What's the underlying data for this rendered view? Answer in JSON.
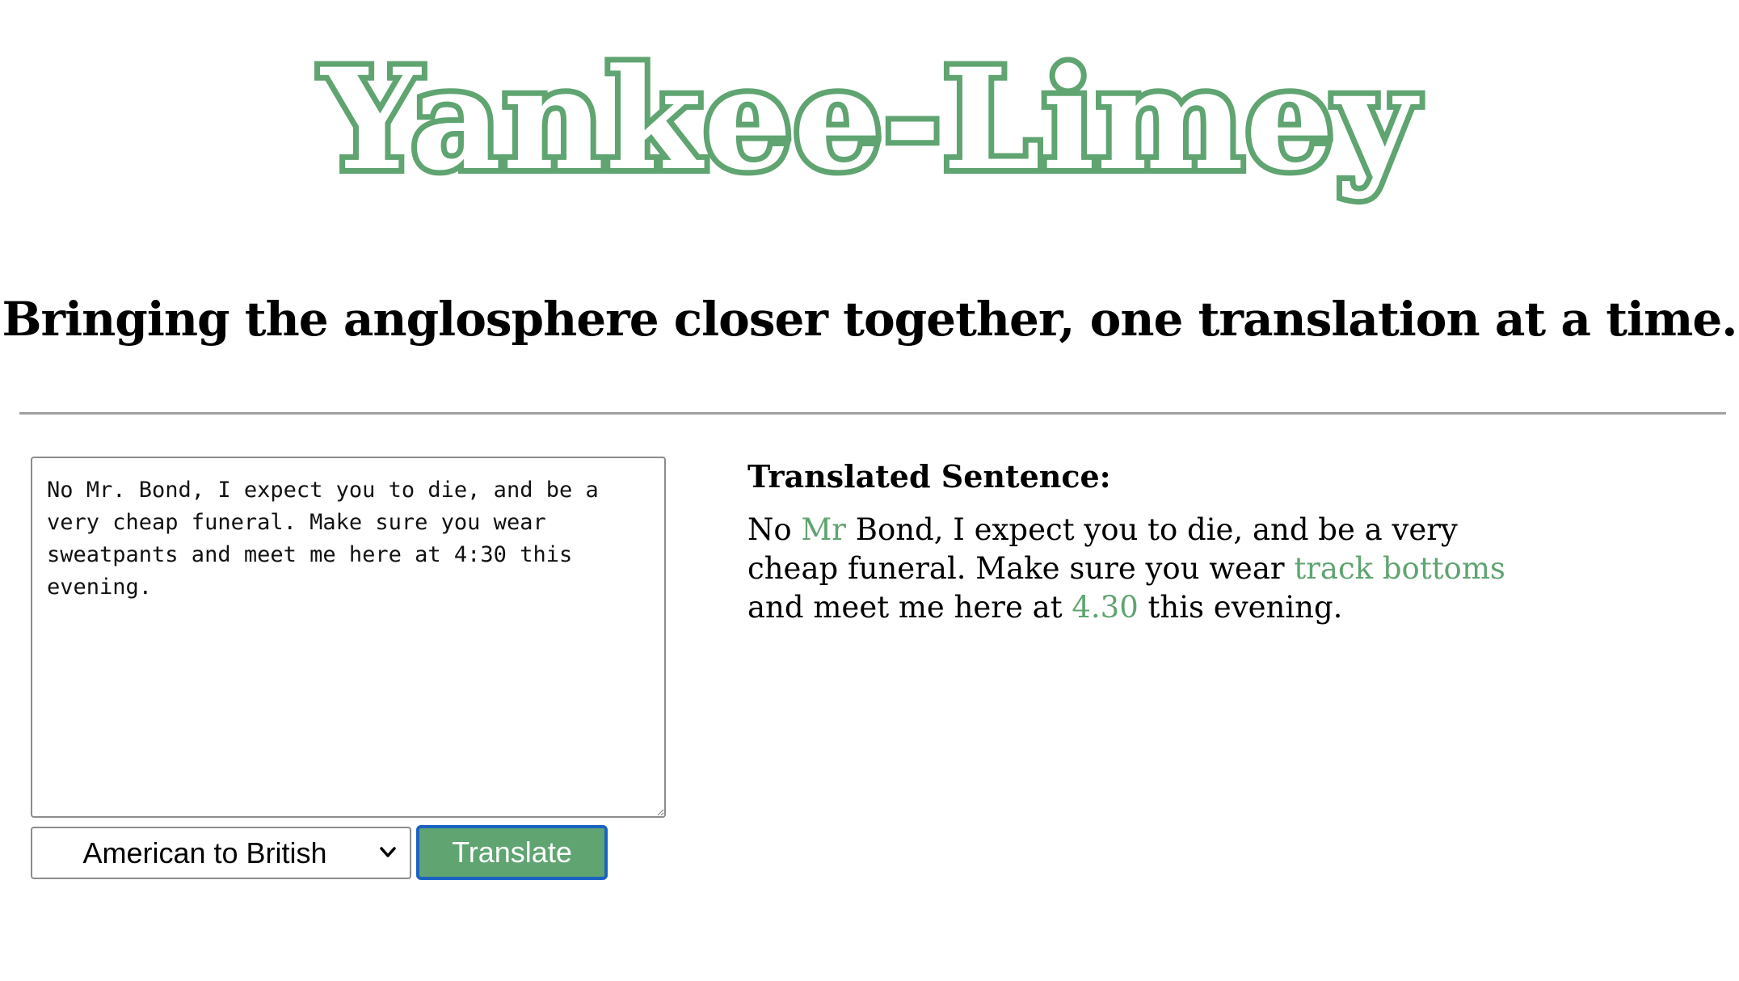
{
  "header": {
    "title": "Yankee-Limey",
    "tagline": "Bringing the anglosphere closer together, one translation at a time."
  },
  "translator": {
    "input_text": "No Mr. Bond, I expect you to die, and be a very cheap funeral. Make sure you wear sweatpants and meet me here at 4:30 this evening.",
    "selected_direction": "American to British",
    "translate_label": "Translate"
  },
  "result": {
    "heading": "Translated Sentence:",
    "segments": [
      {
        "text": "No ",
        "highlight": false
      },
      {
        "text": "Mr",
        "highlight": true
      },
      {
        "text": " Bond, I expect you to die, and be a very cheap funeral. Make sure you wear ",
        "highlight": false
      },
      {
        "text": "track bottoms",
        "highlight": true
      },
      {
        "text": " and meet me here at ",
        "highlight": false
      },
      {
        "text": "4.30",
        "highlight": true
      },
      {
        "text": " this evening.",
        "highlight": false
      }
    ]
  },
  "colors": {
    "accent_green": "#5fa471",
    "button_focus_border": "#1a63c4",
    "divider": "#a0a0a0"
  },
  "icons": {
    "select_arrow": "chevron-down-icon"
  }
}
